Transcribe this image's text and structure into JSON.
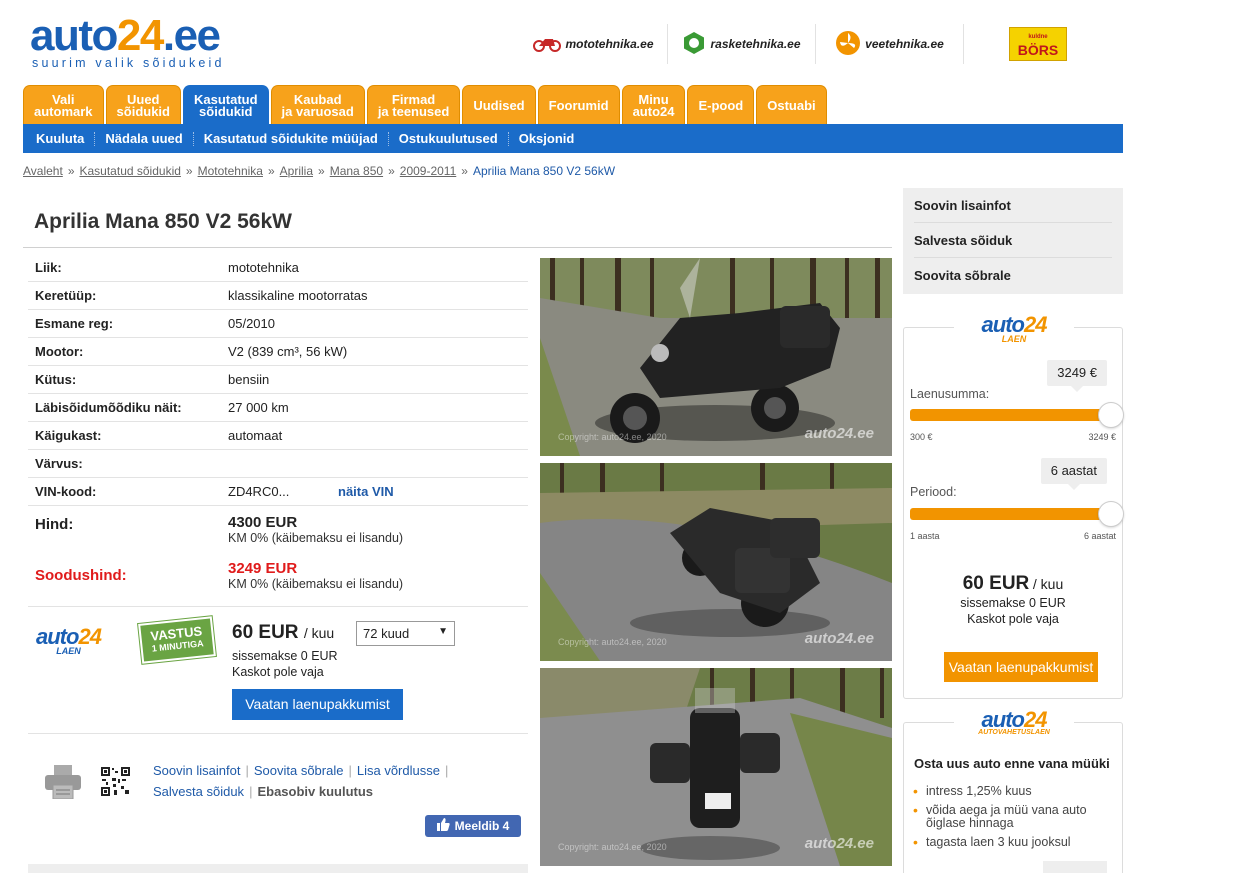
{
  "header": {
    "logo_main_a": "auto",
    "logo_main_b": "24",
    "logo_main_c": ".ee",
    "logo_tagline": "suurim valik sõidukeid",
    "partners": [
      {
        "name": "mototehnika.ee",
        "icon": "motorcycle-icon"
      },
      {
        "name": "rasketehnika.ee",
        "icon": "bolt-nut-icon"
      },
      {
        "name": "veetehnika.ee",
        "icon": "propeller-icon"
      },
      {
        "name": "BÖRS",
        "sub": "kuldne"
      }
    ]
  },
  "tabs": [
    {
      "label": "Vali\nautomark",
      "active": false
    },
    {
      "label": "Uued\nsõidukid",
      "active": false
    },
    {
      "label": "Kasutatud\nsõidukid",
      "active": true
    },
    {
      "label": "Kaubad\nja varuosad",
      "active": false
    },
    {
      "label": "Firmad\nja teenused",
      "active": false
    },
    {
      "label": "Uudised",
      "active": false
    },
    {
      "label": "Foorumid",
      "active": false
    },
    {
      "label": "Minu\nauto24",
      "active": false
    },
    {
      "label": "E-pood",
      "active": false
    },
    {
      "label": "Ostuabi",
      "active": false
    }
  ],
  "subnav": [
    "Kuuluta",
    "Nädala uued",
    "Kasutatud sõidukite müüjad",
    "Ostukuulutused",
    "Oksjonid"
  ],
  "breadcrumb": [
    "Avaleht",
    "Kasutatud sõidukid",
    "Mototehnika",
    "Aprilia",
    "Mana 850",
    "2009-2011",
    "Aprilia Mana 850 V2 56kW"
  ],
  "breadcrumb_sep": "»",
  "listing": {
    "title": "Aprilia Mana 850 V2 56kW",
    "specs": [
      {
        "k": "Liik:",
        "v": "mototehnika"
      },
      {
        "k": "Keretüüp:",
        "v": "klassikaline mootorratas"
      },
      {
        "k": "Esmane reg:",
        "v": "05/2010"
      },
      {
        "k": "Mootor:",
        "v": "V2 (839 cm³, 56 kW)"
      },
      {
        "k": "Kütus:",
        "v": "bensiin"
      },
      {
        "k": "Läbisõidumõõdiku näit:",
        "v": "27 000 km"
      },
      {
        "k": "Käigukast:",
        "v": "automaat"
      },
      {
        "k": "Värvus:",
        "v": ""
      }
    ],
    "vin_label": "VIN-kood:",
    "vin_value": "ZD4RC0...",
    "vin_link": "näita VIN",
    "price_label": "Hind:",
    "price": "4300 EUR",
    "price_note": "KM 0% (käibemaksu ei lisandu)",
    "sale_label": "Soodushind:",
    "sale_price": "3249 EUR",
    "sale_note": "KM 0% (käibemaksu ei lisandu)"
  },
  "loan": {
    "logo_a": "auto",
    "logo_b": "24",
    "logo_sub": "LAEN",
    "badge_top": "VASTUS",
    "badge_bottom": "1 MINUTIGA",
    "monthly": "60 EUR",
    "monthly_unit": "/ kuu",
    "period_select": "72 kuud",
    "down": "sissemakse 0 EUR",
    "insurance": "Kaskot pole vaja",
    "button": "Vaatan laenupakkumist"
  },
  "actions": {
    "more_info": "Soovin lisainfot",
    "recommend": "Soovita sõbrale",
    "compare": "Lisa võrdlusse",
    "save": "Salvesta sõiduk",
    "inappropriate": "Ebasobiv kuulutus",
    "like": "Meeldib 4"
  },
  "photos": {
    "watermark": "auto24.ee",
    "copyright": "Copyright: auto24.ee, 2020"
  },
  "sidebar": {
    "menu": [
      "Soovin lisainfot",
      "Salvesta sõiduk",
      "Soovita sõbrale"
    ],
    "calc": {
      "logo_a": "auto",
      "logo_b": "24",
      "logo_sub": "LAEN",
      "amount_value": "3249 €",
      "amount_label": "Laenusumma:",
      "amount_min": "300 €",
      "amount_max": "3249 €",
      "amount_fraction": 1.0,
      "period_value": "6 aastat",
      "period_label": "Periood:",
      "period_min": "1 aasta",
      "period_max": "6 aastat",
      "period_fraction": 1.0,
      "monthly": "60 EUR",
      "monthly_unit": "/ kuu",
      "down": "sissemakse 0 EUR",
      "insurance": "Kaskot pole vaja",
      "button": "Vaatan laenupakkumist"
    },
    "exchange": {
      "logo_a": "auto",
      "logo_b": "24",
      "logo_sub": "AUTOVAHETUSLAEN",
      "title": "Osta uus auto enne vana müüki",
      "bullets": [
        "intress 1,25% kuus",
        "võida aega ja müü vana auto õiglase hinnaga",
        "tagasta laen 3 kuu jooksul"
      ]
    }
  },
  "colors": {
    "brand_blue": "#1a6cc9",
    "brand_orange": "#f7a21b",
    "sale_red": "#e01b1b"
  }
}
